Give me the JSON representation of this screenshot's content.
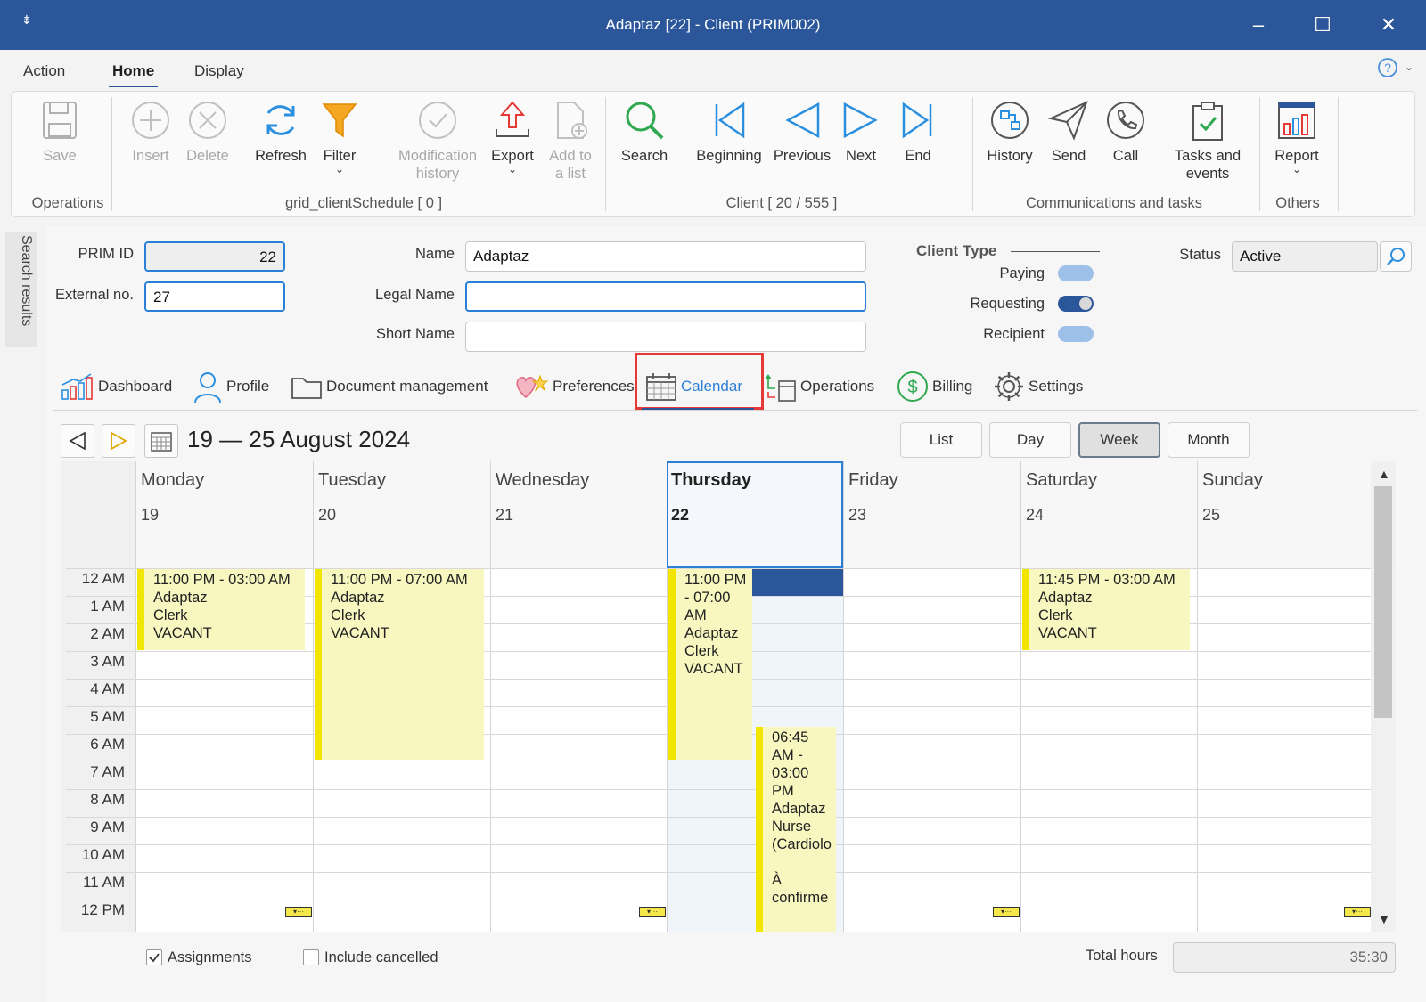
{
  "window": {
    "title": "Adaptaz [22] - Client (PRIM002)"
  },
  "menu": {
    "tabs": [
      "Action",
      "Home",
      "Display"
    ]
  },
  "ribbon": {
    "buttons": {
      "save": "Save",
      "insert": "Insert",
      "delete": "Delete",
      "refresh": "Refresh",
      "filter": "Filter",
      "modification_history": [
        "Modification",
        "history"
      ],
      "export": "Export",
      "add_to_list": [
        "Add to",
        "a list"
      ],
      "search": "Search",
      "beginning": "Beginning",
      "previous": "Previous",
      "next": "Next",
      "end": "End",
      "history": "History",
      "send": "Send",
      "call": "Call",
      "tasks_events": [
        "Tasks and",
        "events"
      ],
      "report": "Report"
    },
    "groups": {
      "operations": "Operations",
      "grid": "grid_clientSchedule [ 0 ]",
      "client": "Client [ 20 / 555 ]",
      "communications": "Communications and tasks",
      "others": "Others"
    }
  },
  "sidebar": {
    "search_results": "Search results"
  },
  "form": {
    "prim_id_label": "PRIM ID",
    "prim_id": "22",
    "external_no_label": "External no.",
    "external_no": "27",
    "name_label": "Name",
    "name": "Adaptaz",
    "legal_name_label": "Legal Name",
    "legal_name": "",
    "short_name_label": "Short Name",
    "short_name": "",
    "client_type_label": "Client Type",
    "paying_label": "Paying",
    "requesting_label": "Requesting",
    "recipient_label": "Recipient",
    "status_label": "Status",
    "status": "Active"
  },
  "tabs": {
    "dashboard": "Dashboard",
    "profile": "Profile",
    "document_management": "Document management",
    "preferences": "Preferences",
    "calendar": "Calendar",
    "operations": "Operations",
    "billing": "Billing",
    "settings": "Settings"
  },
  "calendar": {
    "range": "19 — 25 August 2024",
    "views": [
      "List",
      "Day",
      "Week",
      "Month"
    ],
    "active_view": "Week",
    "days": [
      {
        "name": "Monday",
        "date": "19"
      },
      {
        "name": "Tuesday",
        "date": "20"
      },
      {
        "name": "Wednesday",
        "date": "21"
      },
      {
        "name": "Thursday",
        "date": "22"
      },
      {
        "name": "Friday",
        "date": "23"
      },
      {
        "name": "Saturday",
        "date": "24"
      },
      {
        "name": "Sunday",
        "date": "25"
      }
    ],
    "hours": [
      "12 AM",
      "1 AM",
      "2 AM",
      "3 AM",
      "4 AM",
      "5 AM",
      "6 AM",
      "7 AM",
      "8 AM",
      "9 AM",
      "10 AM",
      "11 AM",
      "12 PM"
    ],
    "events": {
      "mon": [
        "11:00 PM - 03:00 AM",
        "Adaptaz",
        "Clerk",
        "VACANT"
      ],
      "tue": [
        "11:00 PM - 07:00 AM",
        "Adaptaz",
        "Clerk",
        "VACANT"
      ],
      "thu1": [
        "11:00 PM",
        "- 07:00",
        "AM",
        "Adaptaz",
        "Clerk",
        "VACANT"
      ],
      "thu2": [
        "06:45",
        "AM -",
        "03:00",
        "PM",
        "Adaptaz",
        "Nurse",
        "(Cardiolo",
        "",
        "À",
        "confirme"
      ],
      "sat": [
        "11:45 PM - 03:00 AM",
        "Adaptaz",
        "Clerk",
        "VACANT"
      ]
    }
  },
  "footer": {
    "assignments": "Assignments",
    "include_cancelled": "Include cancelled",
    "total_hours_label": "Total hours",
    "total_hours": "35:30"
  },
  "colors": {
    "accent": "#2b579a",
    "event": "#f8f7c0",
    "event_bar": "#f2e600",
    "highlight": "#e53935"
  }
}
